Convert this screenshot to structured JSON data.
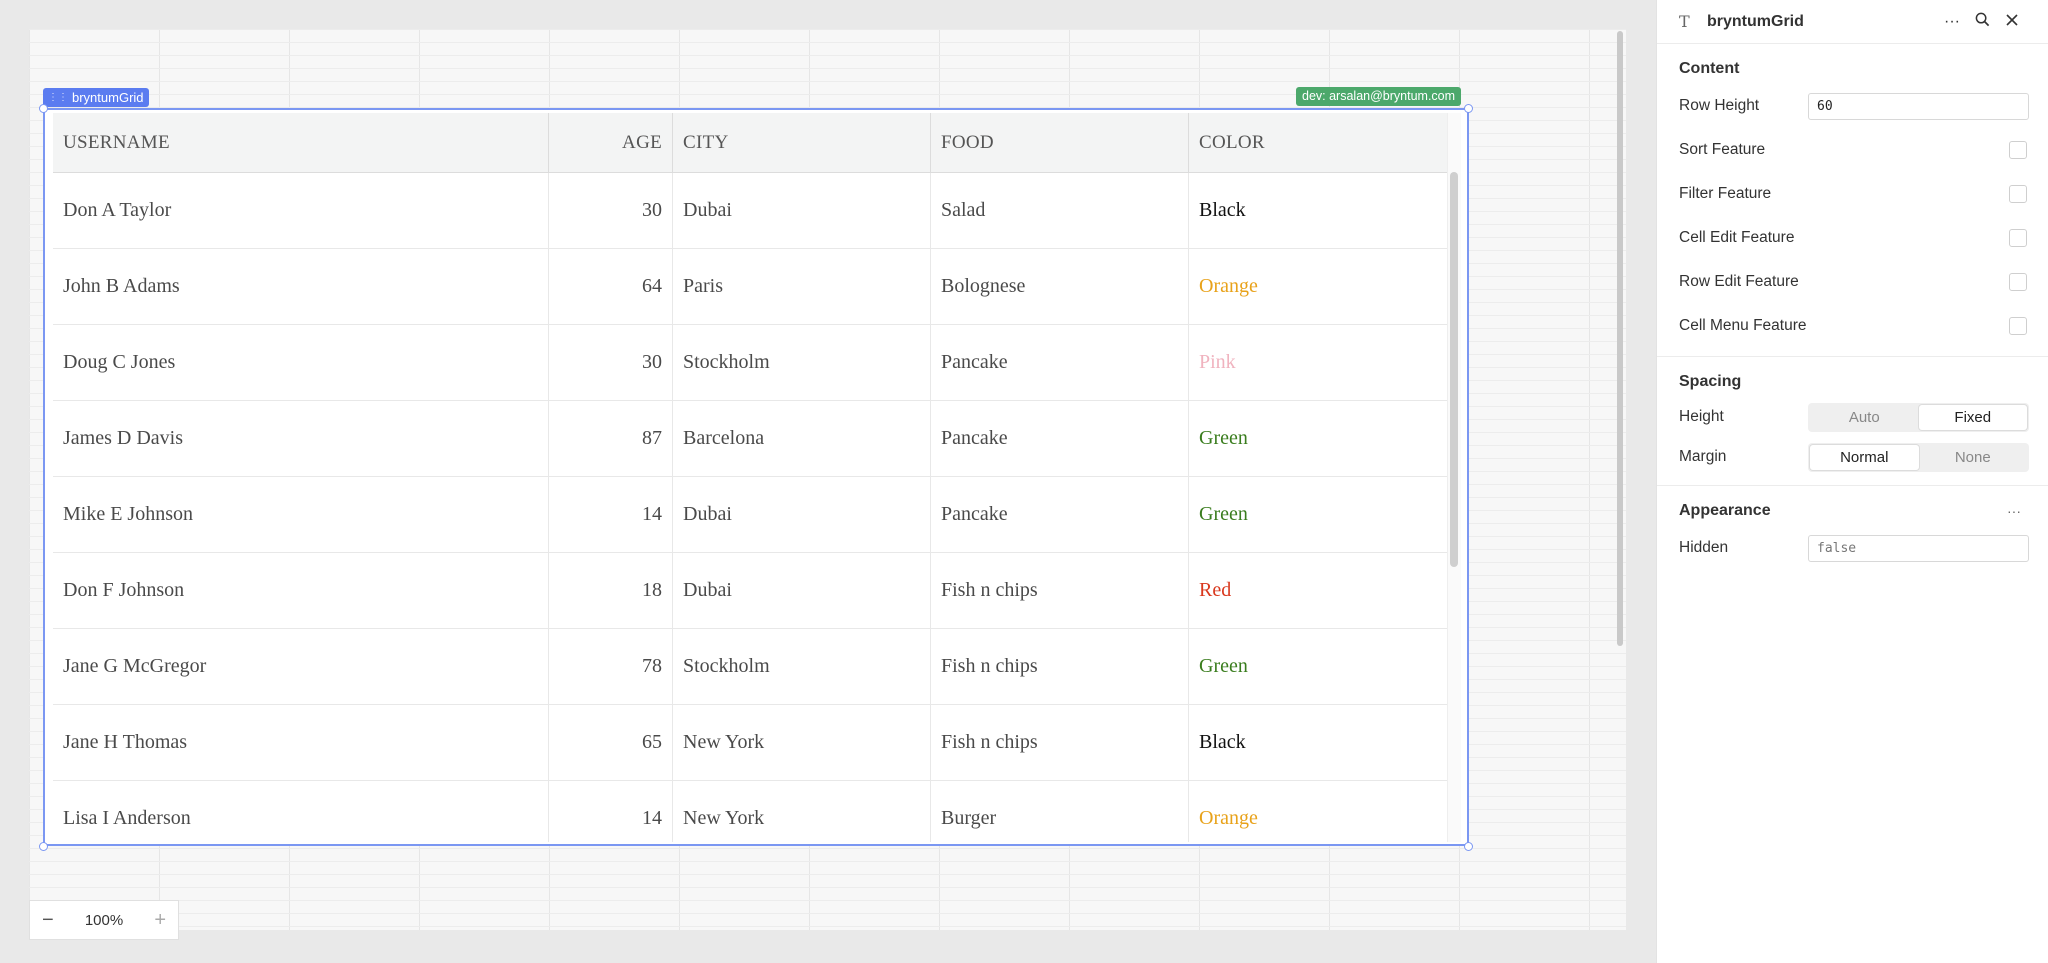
{
  "component_tag": "bryntumGrid",
  "dev_tag": "dev: arsalan@bryntum.com",
  "grid": {
    "columns": [
      "USERNAME",
      "AGE",
      "CITY",
      "FOOD",
      "COLOR"
    ],
    "rows": [
      {
        "username": "Don A Taylor",
        "age": "30",
        "city": "Dubai",
        "food": "Salad",
        "color": "Black",
        "color_hex": "#111111"
      },
      {
        "username": "John B Adams",
        "age": "64",
        "city": "Paris",
        "food": "Bolognese",
        "color": "Orange",
        "color_hex": "#e8a21a"
      },
      {
        "username": "Doug C Jones",
        "age": "30",
        "city": "Stockholm",
        "food": "Pancake",
        "color": "Pink",
        "color_hex": "#f0b3bf"
      },
      {
        "username": "James D Davis",
        "age": "87",
        "city": "Barcelona",
        "food": "Pancake",
        "color": "Green",
        "color_hex": "#3a7d1e"
      },
      {
        "username": "Mike E Johnson",
        "age": "14",
        "city": "Dubai",
        "food": "Pancake",
        "color": "Green",
        "color_hex": "#3a7d1e"
      },
      {
        "username": "Don F Johnson",
        "age": "18",
        "city": "Dubai",
        "food": "Fish n chips",
        "color": "Red",
        "color_hex": "#d9381e"
      },
      {
        "username": "Jane G McGregor",
        "age": "78",
        "city": "Stockholm",
        "food": "Fish n chips",
        "color": "Green",
        "color_hex": "#3a7d1e"
      },
      {
        "username": "Jane H Thomas",
        "age": "65",
        "city": "New York",
        "food": "Fish n chips",
        "color": "Black",
        "color_hex": "#111111"
      },
      {
        "username": "Lisa I Anderson",
        "age": "14",
        "city": "New York",
        "food": "Burger",
        "color": "Orange",
        "color_hex": "#e8a21a"
      }
    ]
  },
  "zoom": {
    "minus": "−",
    "level": "100%",
    "plus": "+"
  },
  "panel": {
    "title": "bryntumGrid",
    "type_icon": "T",
    "icons": {
      "more": "more-horizontal-icon",
      "search": "search-icon",
      "close": "close-icon"
    },
    "content": {
      "title": "Content",
      "row_height_label": "Row Height",
      "row_height_value": "60",
      "features": [
        "Sort Feature",
        "Filter Feature",
        "Cell Edit Feature",
        "Row Edit Feature",
        "Cell Menu Feature"
      ]
    },
    "spacing": {
      "title": "Spacing",
      "height_label": "Height",
      "height_options": [
        "Auto",
        "Fixed"
      ],
      "height_selected": "Fixed",
      "margin_label": "Margin",
      "margin_options": [
        "Normal",
        "None"
      ],
      "margin_selected": "Normal"
    },
    "appearance": {
      "title": "Appearance",
      "more": "···",
      "hidden_label": "Hidden",
      "hidden_value": "false"
    }
  },
  "colors": {
    "accent": "#5b7cf0",
    "dev_tag": "#4ca86b",
    "selection": "#7b97f2"
  }
}
